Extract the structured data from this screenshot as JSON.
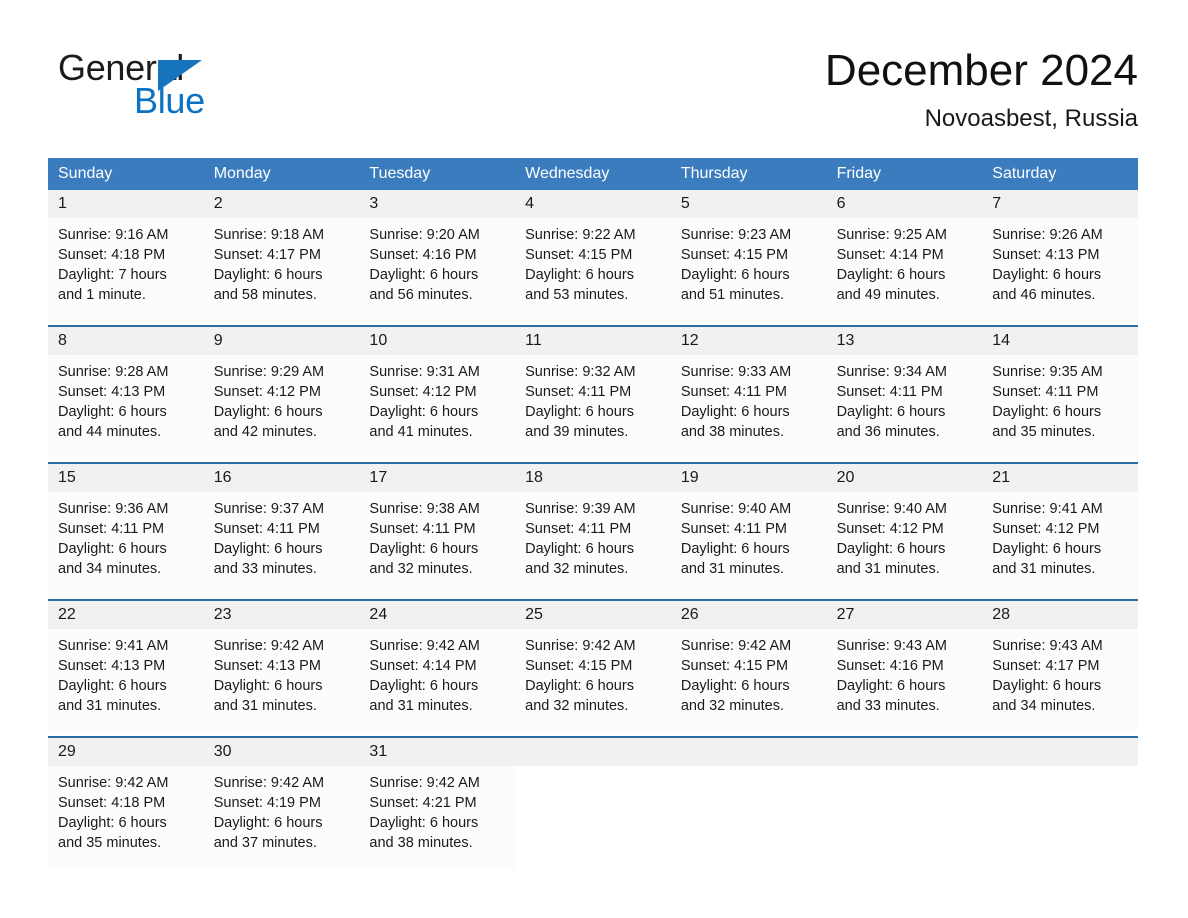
{
  "brand": {
    "name_part1": "General",
    "name_part2": "Blue",
    "logo_icon": "triangle-icon"
  },
  "header": {
    "month_title": "December 2024",
    "location": "Novoasbest, Russia"
  },
  "calendar": {
    "weekday_headers": [
      "Sunday",
      "Monday",
      "Tuesday",
      "Wednesday",
      "Thursday",
      "Friday",
      "Saturday"
    ],
    "accent_color": "#3a7cbd",
    "row_border_color": "#2e6da4",
    "datestrip_color": "#f1f1f1",
    "weeks": [
      {
        "days": [
          {
            "num": "1",
            "sunrise": "Sunrise: 9:16 AM",
            "sunset": "Sunset: 4:18 PM",
            "daylight1": "Daylight: 7 hours",
            "daylight2": "and 1 minute."
          },
          {
            "num": "2",
            "sunrise": "Sunrise: 9:18 AM",
            "sunset": "Sunset: 4:17 PM",
            "daylight1": "Daylight: 6 hours",
            "daylight2": "and 58 minutes."
          },
          {
            "num": "3",
            "sunrise": "Sunrise: 9:20 AM",
            "sunset": "Sunset: 4:16 PM",
            "daylight1": "Daylight: 6 hours",
            "daylight2": "and 56 minutes."
          },
          {
            "num": "4",
            "sunrise": "Sunrise: 9:22 AM",
            "sunset": "Sunset: 4:15 PM",
            "daylight1": "Daylight: 6 hours",
            "daylight2": "and 53 minutes."
          },
          {
            "num": "5",
            "sunrise": "Sunrise: 9:23 AM",
            "sunset": "Sunset: 4:15 PM",
            "daylight1": "Daylight: 6 hours",
            "daylight2": "and 51 minutes."
          },
          {
            "num": "6",
            "sunrise": "Sunrise: 9:25 AM",
            "sunset": "Sunset: 4:14 PM",
            "daylight1": "Daylight: 6 hours",
            "daylight2": "and 49 minutes."
          },
          {
            "num": "7",
            "sunrise": "Sunrise: 9:26 AM",
            "sunset": "Sunset: 4:13 PM",
            "daylight1": "Daylight: 6 hours",
            "daylight2": "and 46 minutes."
          }
        ]
      },
      {
        "days": [
          {
            "num": "8",
            "sunrise": "Sunrise: 9:28 AM",
            "sunset": "Sunset: 4:13 PM",
            "daylight1": "Daylight: 6 hours",
            "daylight2": "and 44 minutes."
          },
          {
            "num": "9",
            "sunrise": "Sunrise: 9:29 AM",
            "sunset": "Sunset: 4:12 PM",
            "daylight1": "Daylight: 6 hours",
            "daylight2": "and 42 minutes."
          },
          {
            "num": "10",
            "sunrise": "Sunrise: 9:31 AM",
            "sunset": "Sunset: 4:12 PM",
            "daylight1": "Daylight: 6 hours",
            "daylight2": "and 41 minutes."
          },
          {
            "num": "11",
            "sunrise": "Sunrise: 9:32 AM",
            "sunset": "Sunset: 4:11 PM",
            "daylight1": "Daylight: 6 hours",
            "daylight2": "and 39 minutes."
          },
          {
            "num": "12",
            "sunrise": "Sunrise: 9:33 AM",
            "sunset": "Sunset: 4:11 PM",
            "daylight1": "Daylight: 6 hours",
            "daylight2": "and 38 minutes."
          },
          {
            "num": "13",
            "sunrise": "Sunrise: 9:34 AM",
            "sunset": "Sunset: 4:11 PM",
            "daylight1": "Daylight: 6 hours",
            "daylight2": "and 36 minutes."
          },
          {
            "num": "14",
            "sunrise": "Sunrise: 9:35 AM",
            "sunset": "Sunset: 4:11 PM",
            "daylight1": "Daylight: 6 hours",
            "daylight2": "and 35 minutes."
          }
        ]
      },
      {
        "days": [
          {
            "num": "15",
            "sunrise": "Sunrise: 9:36 AM",
            "sunset": "Sunset: 4:11 PM",
            "daylight1": "Daylight: 6 hours",
            "daylight2": "and 34 minutes."
          },
          {
            "num": "16",
            "sunrise": "Sunrise: 9:37 AM",
            "sunset": "Sunset: 4:11 PM",
            "daylight1": "Daylight: 6 hours",
            "daylight2": "and 33 minutes."
          },
          {
            "num": "17",
            "sunrise": "Sunrise: 9:38 AM",
            "sunset": "Sunset: 4:11 PM",
            "daylight1": "Daylight: 6 hours",
            "daylight2": "and 32 minutes."
          },
          {
            "num": "18",
            "sunrise": "Sunrise: 9:39 AM",
            "sunset": "Sunset: 4:11 PM",
            "daylight1": "Daylight: 6 hours",
            "daylight2": "and 32 minutes."
          },
          {
            "num": "19",
            "sunrise": "Sunrise: 9:40 AM",
            "sunset": "Sunset: 4:11 PM",
            "daylight1": "Daylight: 6 hours",
            "daylight2": "and 31 minutes."
          },
          {
            "num": "20",
            "sunrise": "Sunrise: 9:40 AM",
            "sunset": "Sunset: 4:12 PM",
            "daylight1": "Daylight: 6 hours",
            "daylight2": "and 31 minutes."
          },
          {
            "num": "21",
            "sunrise": "Sunrise: 9:41 AM",
            "sunset": "Sunset: 4:12 PM",
            "daylight1": "Daylight: 6 hours",
            "daylight2": "and 31 minutes."
          }
        ]
      },
      {
        "days": [
          {
            "num": "22",
            "sunrise": "Sunrise: 9:41 AM",
            "sunset": "Sunset: 4:13 PM",
            "daylight1": "Daylight: 6 hours",
            "daylight2": "and 31 minutes."
          },
          {
            "num": "23",
            "sunrise": "Sunrise: 9:42 AM",
            "sunset": "Sunset: 4:13 PM",
            "daylight1": "Daylight: 6 hours",
            "daylight2": "and 31 minutes."
          },
          {
            "num": "24",
            "sunrise": "Sunrise: 9:42 AM",
            "sunset": "Sunset: 4:14 PM",
            "daylight1": "Daylight: 6 hours",
            "daylight2": "and 31 minutes."
          },
          {
            "num": "25",
            "sunrise": "Sunrise: 9:42 AM",
            "sunset": "Sunset: 4:15 PM",
            "daylight1": "Daylight: 6 hours",
            "daylight2": "and 32 minutes."
          },
          {
            "num": "26",
            "sunrise": "Sunrise: 9:42 AM",
            "sunset": "Sunset: 4:15 PM",
            "daylight1": "Daylight: 6 hours",
            "daylight2": "and 32 minutes."
          },
          {
            "num": "27",
            "sunrise": "Sunrise: 9:43 AM",
            "sunset": "Sunset: 4:16 PM",
            "daylight1": "Daylight: 6 hours",
            "daylight2": "and 33 minutes."
          },
          {
            "num": "28",
            "sunrise": "Sunrise: 9:43 AM",
            "sunset": "Sunset: 4:17 PM",
            "daylight1": "Daylight: 6 hours",
            "daylight2": "and 34 minutes."
          }
        ]
      },
      {
        "days": [
          {
            "num": "29",
            "sunrise": "Sunrise: 9:42 AM",
            "sunset": "Sunset: 4:18 PM",
            "daylight1": "Daylight: 6 hours",
            "daylight2": "and 35 minutes."
          },
          {
            "num": "30",
            "sunrise": "Sunrise: 9:42 AM",
            "sunset": "Sunset: 4:19 PM",
            "daylight1": "Daylight: 6 hours",
            "daylight2": "and 37 minutes."
          },
          {
            "num": "31",
            "sunrise": "Sunrise: 9:42 AM",
            "sunset": "Sunset: 4:21 PM",
            "daylight1": "Daylight: 6 hours",
            "daylight2": "and 38 minutes."
          },
          {
            "num": "",
            "sunrise": "",
            "sunset": "",
            "daylight1": "",
            "daylight2": ""
          },
          {
            "num": "",
            "sunrise": "",
            "sunset": "",
            "daylight1": "",
            "daylight2": ""
          },
          {
            "num": "",
            "sunrise": "",
            "sunset": "",
            "daylight1": "",
            "daylight2": ""
          },
          {
            "num": "",
            "sunrise": "",
            "sunset": "",
            "daylight1": "",
            "daylight2": ""
          }
        ]
      }
    ]
  }
}
